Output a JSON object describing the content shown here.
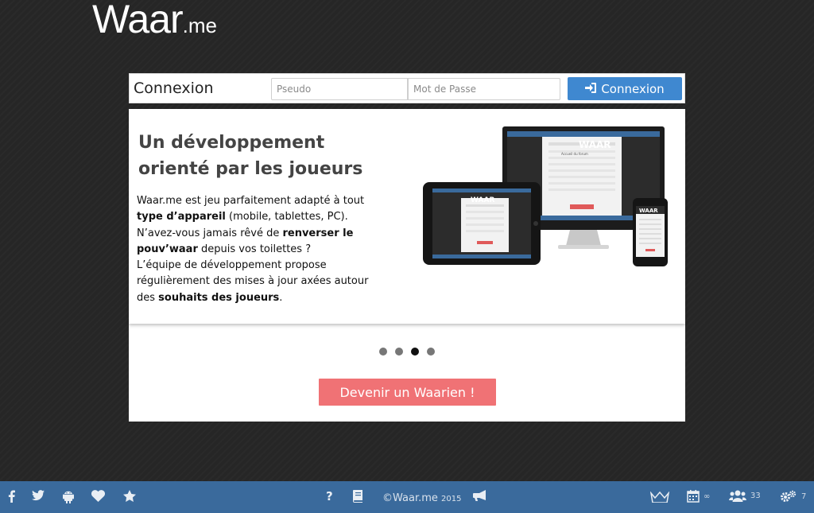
{
  "brand": {
    "logo_main": "Waar",
    "logo_suffix": ".me"
  },
  "login": {
    "title": "Connexion",
    "pseudo_placeholder": "Pseudo",
    "password_placeholder": "Mot de Passe",
    "submit_label": "Connexion"
  },
  "slide": {
    "title": "Un développement orienté par les joueurs",
    "paragraph": {
      "p1": "Waar.me est jeu parfaitement adapté à tout ",
      "p1_bold": "type d’appareil",
      "p2": " (mobile, tablettes, PC).",
      "p3": "N’avez-vous jamais rêvé de ",
      "p3_bold": "renverser le pouv’waar",
      "p4": " depuis vos toilettes ?",
      "p5": "L’équipe de développement propose régulièrement des mises à jour axées autour des ",
      "p5_bold": "souhaits des joueurs",
      "p6": "."
    },
    "device_logo": "WAAR",
    "device_screen_title": "Accueil du forum"
  },
  "carousel": {
    "dot_count": 4,
    "active_index": 2
  },
  "cta_label": "Devenir un Waarien !",
  "footer": {
    "copyright": "©Waar.me",
    "year": "2015",
    "calendar_count": "∞",
    "players_count": "33",
    "settings_count": "7",
    "help_label": "?"
  },
  "colors": {
    "background": "#262626",
    "accent_blue": "#3f88d0",
    "footer_blue": "#3a6a9c",
    "cta_red": "#f07275"
  }
}
